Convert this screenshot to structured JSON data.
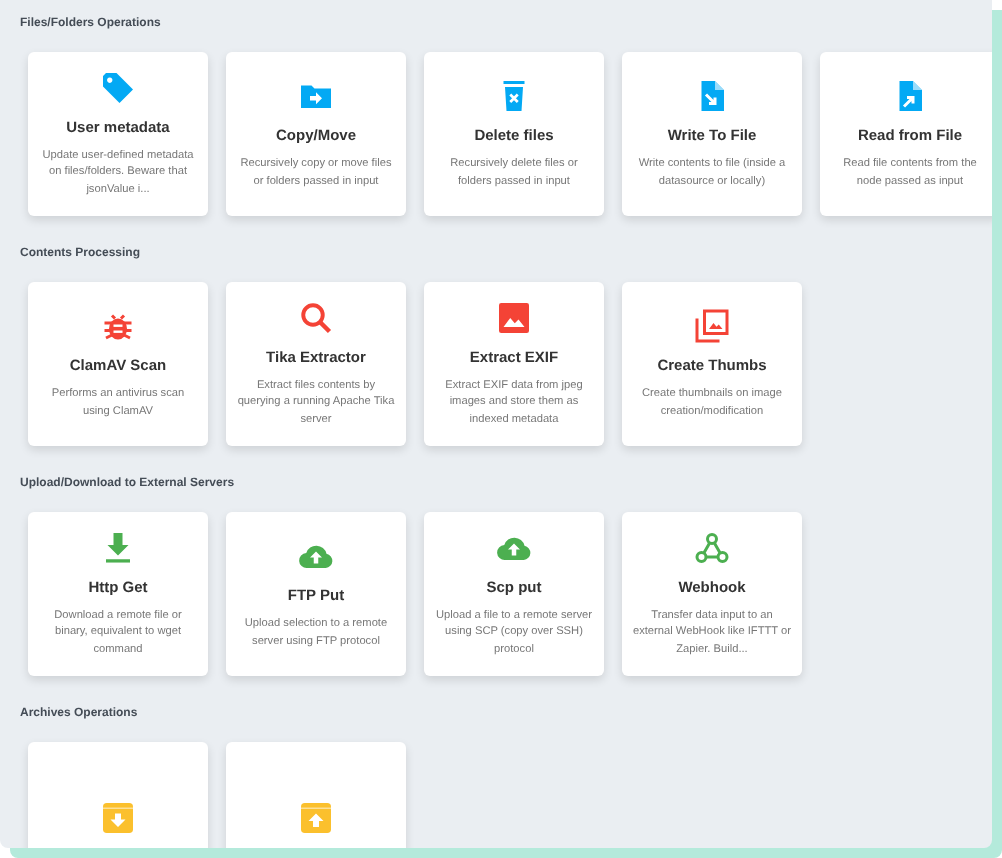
{
  "sections": [
    {
      "title": "Files/Folders Operations",
      "color": "#03a9f4",
      "cards": [
        {
          "kind": "tag",
          "title": "User metadata",
          "description": "Update user-defined metadata on files/folders. Beware that jsonValue i..."
        },
        {
          "kind": "folder-arrow",
          "title": "Copy/Move",
          "description": "Recursively copy or move files or folders passed in input"
        },
        {
          "kind": "trash",
          "title": "Delete files",
          "description": "Recursively delete files or folders passed in input"
        },
        {
          "kind": "file-in",
          "title": "Write To File",
          "description": "Write contents to file (inside a datasource or locally)"
        },
        {
          "kind": "file-out",
          "title": "Read from File",
          "description": "Read file contents from the node passed as input"
        }
      ]
    },
    {
      "title": "Contents Processing",
      "color": "#f44336",
      "cards": [
        {
          "kind": "bug",
          "title": "ClamAV Scan",
          "description": "Performs an antivirus scan using ClamAV"
        },
        {
          "kind": "search",
          "title": "Tika Extractor",
          "description": "Extract files contents by querying a running Apache Tika server"
        },
        {
          "kind": "image",
          "title": "Extract EXIF",
          "description": "Extract EXIF data from jpeg images and store them as indexed metadata"
        },
        {
          "kind": "images",
          "title": "Create Thumbs",
          "description": "Create thumbnails on image creation/modification"
        }
      ]
    },
    {
      "title": "Upload/Download to External Servers",
      "color": "#4caf50",
      "cards": [
        {
          "kind": "download",
          "title": "Http Get",
          "description": "Download a remote file or binary, equivalent to wget command"
        },
        {
          "kind": "cloud-upload",
          "title": "FTP Put",
          "description": "Upload selection to a remote server using FTP protocol"
        },
        {
          "kind": "cloud-upload",
          "title": "Scp put",
          "description": "Upload a file to a remote server using SCP (copy over SSH) protocol"
        },
        {
          "kind": "webhook",
          "title": "Webhook",
          "description": "Transfer data input to an external WebHook like IFTTT or Zapier. Build..."
        }
      ]
    },
    {
      "title": "Archives Operations",
      "color": "#fbc02d",
      "cards": [
        {
          "kind": "archive-down"
        },
        {
          "kind": "archive-up"
        }
      ]
    }
  ]
}
